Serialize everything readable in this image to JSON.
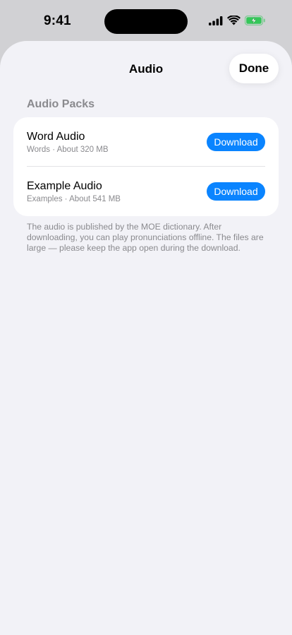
{
  "status_bar": {
    "time": "9:41",
    "icons": [
      "cellular-signal-icon",
      "wifi-icon",
      "battery-charging-icon"
    ],
    "battery_color": "#34c759"
  },
  "nav": {
    "title": "Audio",
    "done_label": "Done"
  },
  "section": {
    "header": "Audio Packs",
    "items": [
      {
        "title": "Word Audio",
        "subtitle": "Words · About 320 MB",
        "button_label": "Download"
      },
      {
        "title": "Example Audio",
        "subtitle": "Examples · About 541 MB",
        "button_label": "Download"
      }
    ],
    "footer": "The audio is published by the MOE dictionary. After downloading, you can play pronunciations offline. The files are large — please keep the app open during the download."
  },
  "colors": {
    "accent": "#0a84ff",
    "background": "#f2f2f7",
    "secondary_text": "#8a8a8e"
  }
}
